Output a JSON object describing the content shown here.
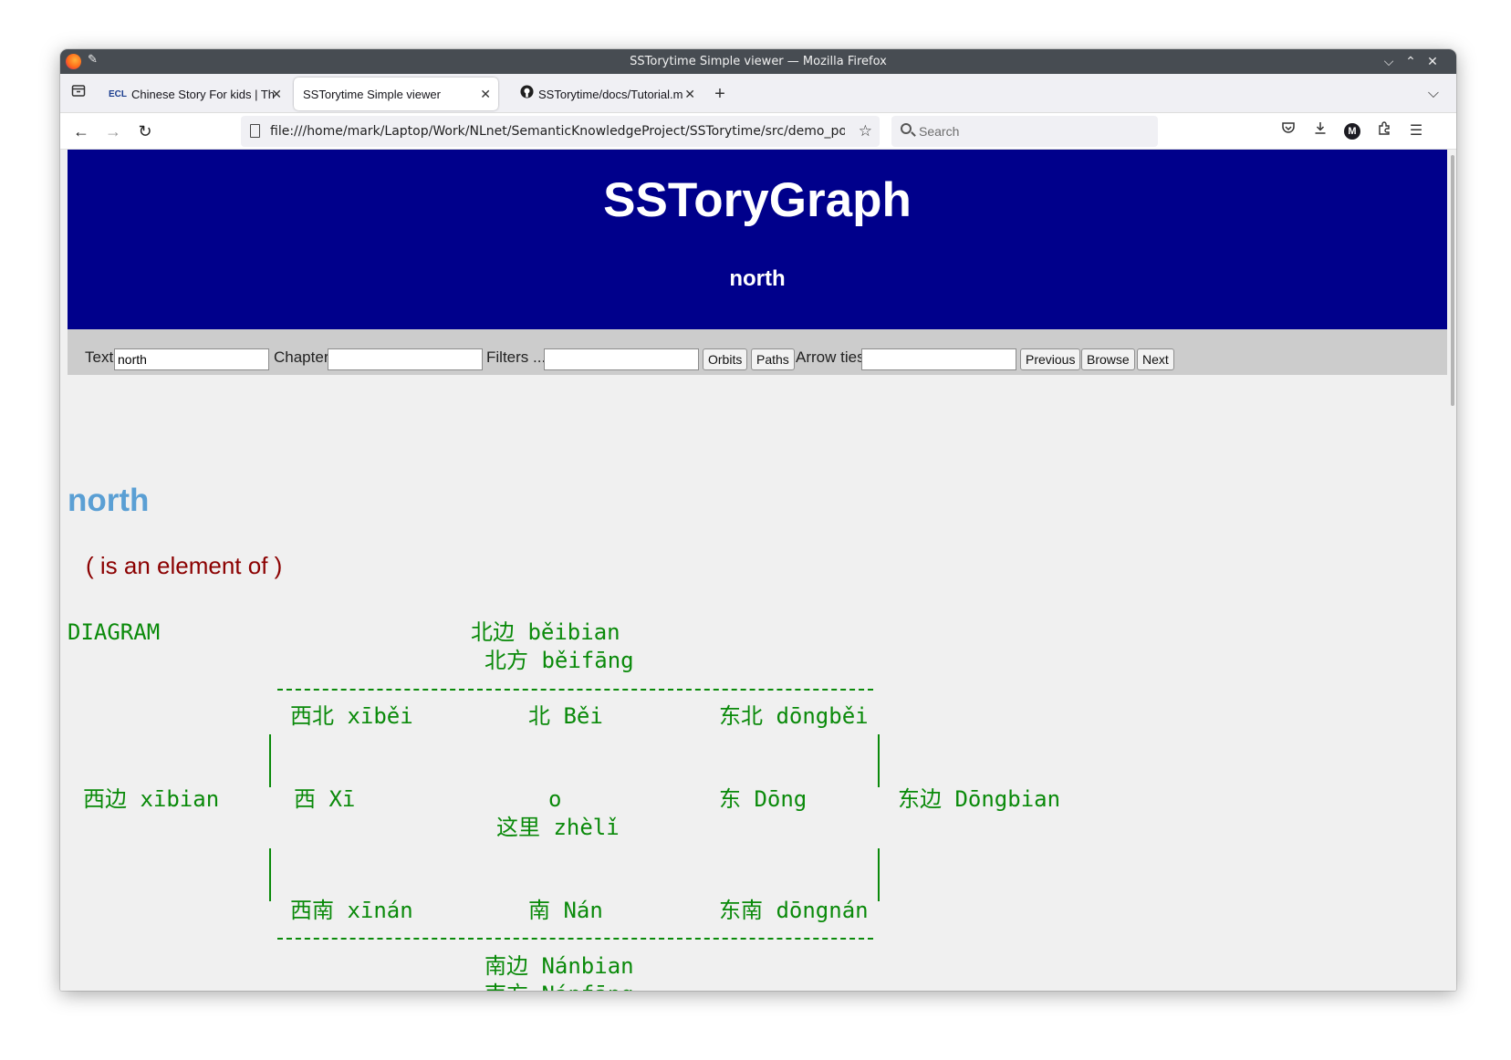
{
  "window": {
    "title": "SSTorytime Simple viewer — Mozilla Firefox"
  },
  "tabs": [
    {
      "label": "Chinese Story For kids | Th",
      "icon": "ecl-favicon-icon"
    },
    {
      "label": "SSTorytime Simple viewer",
      "icon": ""
    },
    {
      "label": "SSTorytime/docs/Tutorial.m",
      "icon": "github-icon"
    }
  ],
  "nav": {
    "url": "file:///home/mark/Laptop/Work/NLnet/SemanticKnowledgeProject/SSTorytime/src/demo_pocs/page.",
    "search_placeholder": "Search",
    "avatar_letter": "M"
  },
  "page": {
    "title": "SSToryGraph",
    "subtitle": "north",
    "form": {
      "text_label": "Text",
      "text_value": "north",
      "chapter_label": "Chapter",
      "chapter_value": "",
      "filters_label": "Filters ...",
      "filters_value": "",
      "orbits_button": "Orbits",
      "paths_button": "Paths",
      "arrow_ties_label": "Arrow ties",
      "arrow_ties_value": "",
      "previous_button": "Previous",
      "browse_button": "Browse",
      "next_button": "Next"
    },
    "heading": "north",
    "relation": "( is an element of )",
    "diagram": {
      "label": "DIAGRAM",
      "north_region_1": "北边 běibian",
      "north_region_2": "北方 běifāng",
      "northwest": "西北 xīběi",
      "north": "北 Běi",
      "northeast": "东北 dōngběi",
      "west_region": "西边 xībian",
      "west": "西 Xī",
      "center": "o",
      "east": "东 Dōng",
      "east_region": "东边 Dōngbian",
      "here": "这里 zhèlǐ",
      "southwest": "西南 xīnán",
      "south": "南 Nán",
      "southeast": "东南 dōngnán",
      "south_region_1": "南边 Nánbian",
      "south_region_2": "南方 Nánfāng"
    }
  },
  "colors": {
    "banner": "#00008b",
    "form_bar": "#cccccc",
    "heading": "#5a9fd4",
    "relation": "#8b0000",
    "diagram": "#0a8a0a"
  }
}
